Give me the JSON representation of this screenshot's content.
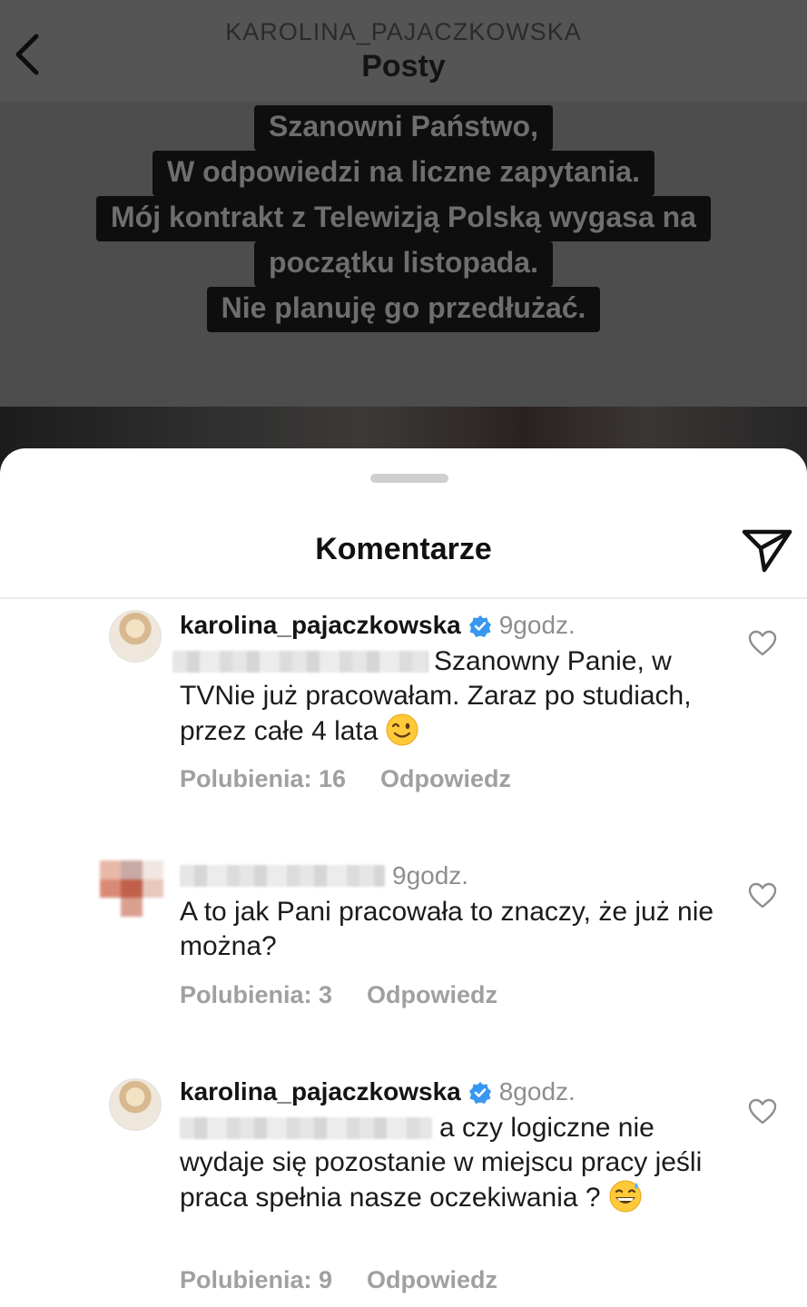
{
  "header": {
    "username": "KAROLINA_PAJACZKOWSKA",
    "title": "Posty",
    "back_icon": "chevron-left-icon"
  },
  "post": {
    "story_lines": [
      "Szanowni Państwo,",
      "W odpowiedzi na liczne zapytania.",
      "Mój kontrakt z Telewizją Polską wygasa na",
      "początku listopada.",
      "Nie planuję go  przedłużać."
    ]
  },
  "comments_sheet": {
    "title": "Komentarze",
    "share_icon": "paper-plane-icon",
    "comments": [
      {
        "username": "karolina_pajaczkowska",
        "verified": true,
        "time": "9godz.",
        "text": "Szanowny Panie, w TVNie już pracowałam. Zaraz po studiach, przez całe 4 lata",
        "emoji": "winking-face-emoji",
        "likes_label": "Polubienia: 16",
        "reply_label": "Odpowiedz"
      },
      {
        "username": "",
        "verified": false,
        "time": "9godz.",
        "text": "A to jak Pani pracowała to znaczy, że już nie można?",
        "likes_label": "Polubienia: 3",
        "reply_label": "Odpowiedz"
      },
      {
        "username": "karolina_pajaczkowska",
        "verified": true,
        "time": "8godz.",
        "text": "a czy logiczne nie wydaje się pozostanie w miejscu pracy jeśli praca spełnia nasze oczekiwania ?",
        "emoji": "grinning-face-with-sweat-emoji",
        "likes_label": "Polubienia: 9",
        "reply_label": "Odpowiedz"
      }
    ]
  },
  "colors": {
    "verified_badge": "#3897f0",
    "secondary_text": "#8e8e8e",
    "action_text": "#a0a0a0",
    "overlay": "#4a4a4a"
  }
}
